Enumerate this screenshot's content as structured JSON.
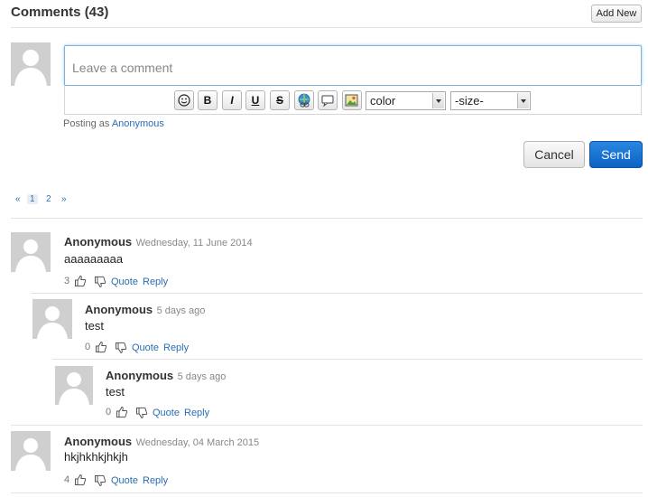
{
  "header": {
    "title": "Comments",
    "count": "(43)",
    "add_new_label": "Add New"
  },
  "editor": {
    "placeholder": "Leave a comment",
    "toolbar": {
      "buttons": [
        "smiley-icon",
        "B",
        "I",
        "U",
        "S",
        "link-icon",
        "quote-icon",
        "image-icon"
      ],
      "color_select": "color",
      "size_select": "-size-"
    },
    "posting_prefix": "Posting as",
    "posting_user": "Anonymous",
    "cancel_label": "Cancel",
    "send_label": "Send"
  },
  "pagination": {
    "prev": "«",
    "pages": [
      "1",
      "2"
    ],
    "next": "»",
    "current": "1"
  },
  "comments": [
    {
      "author": "Anonymous",
      "date": "Wednesday, 11 June 2014",
      "text": "aaaaaaaaa",
      "votes": "3",
      "quote": "Quote",
      "reply": "Reply"
    },
    {
      "author": "Anonymous",
      "date": "5 days ago",
      "text": "test",
      "votes": "0",
      "quote": "Quote",
      "reply": "Reply"
    },
    {
      "author": "Anonymous",
      "date": "5 days ago",
      "text": "test",
      "votes": "0",
      "quote": "Quote",
      "reply": "Reply"
    },
    {
      "author": "Anonymous",
      "date": "Wednesday, 04 March 2015",
      "text": "hkjhkhkjhkjh",
      "votes": "4",
      "quote": "Quote",
      "reply": "Reply"
    }
  ],
  "colors": {
    "link": "#2a6db2",
    "send_button": "#0c63c5",
    "avatar_bg": "#cfcfcf",
    "avatar_fg": "#ffffff"
  }
}
